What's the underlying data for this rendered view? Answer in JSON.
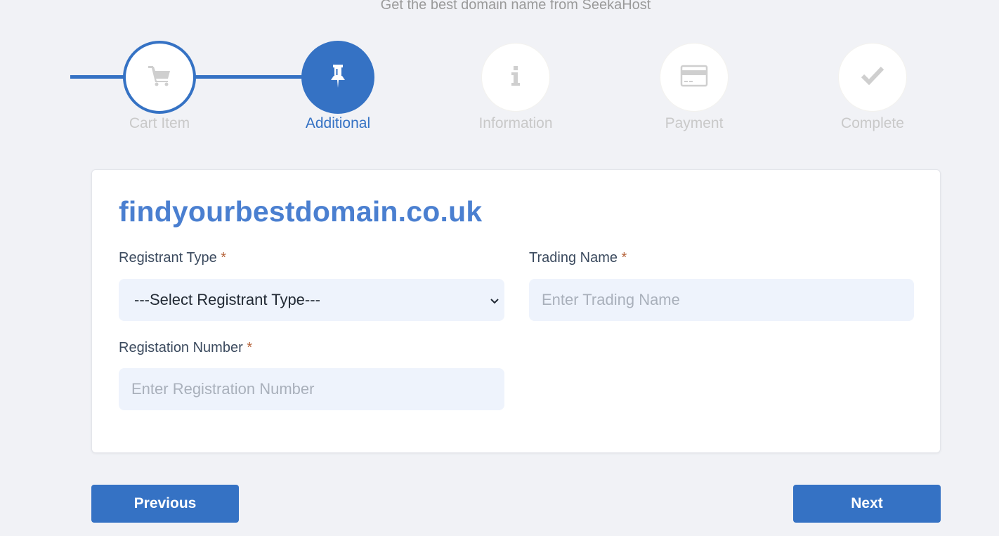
{
  "header": {
    "subtitle": "Get the best domain name from SeekaHost"
  },
  "stepper": {
    "accent_color": "#3572c4",
    "current_step": 2,
    "steps": [
      {
        "label": "Cart Item",
        "icon": "cart-icon",
        "state": "done"
      },
      {
        "label": "Additional",
        "icon": "pushpin-icon",
        "state": "active"
      },
      {
        "label": "Information",
        "icon": "info-icon",
        "state": "pending"
      },
      {
        "label": "Payment",
        "icon": "credit-card-icon",
        "state": "pending"
      },
      {
        "label": "Complete",
        "icon": "check-icon",
        "state": "pending"
      }
    ]
  },
  "form": {
    "domain": "findyourbestdomain.co.uk",
    "required_marker": "*",
    "registrant_type": {
      "label": "Registrant Type",
      "selected": "---Select Registrant Type---"
    },
    "trading_name": {
      "label": "Trading Name",
      "placeholder": "Enter Trading Name",
      "value": ""
    },
    "registration_number": {
      "label": "Registation Number",
      "placeholder": "Enter Registration Number",
      "value": ""
    }
  },
  "navigation": {
    "previous_label": "Previous",
    "next_label": "Next"
  }
}
